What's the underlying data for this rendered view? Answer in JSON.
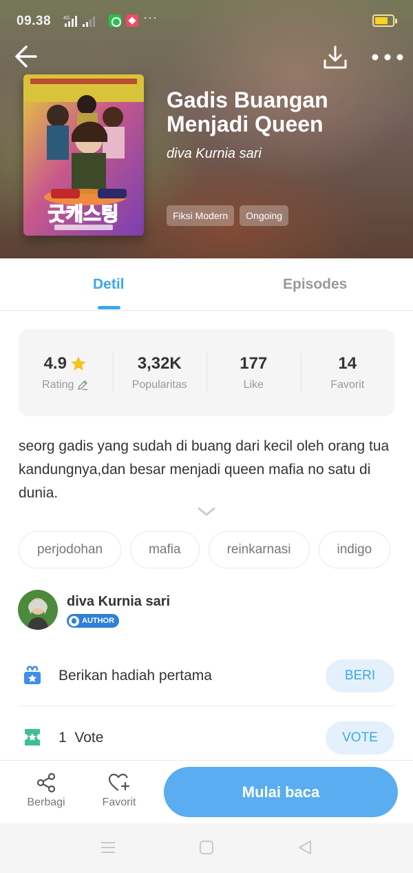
{
  "status_bar": {
    "time": "09.38",
    "network": "4G",
    "more": "···"
  },
  "book": {
    "title": "Gadis Buangan Menjadi Queen",
    "author": "diva Kurnia sari",
    "tags": [
      "Fiksi Modern",
      "Ongoing"
    ]
  },
  "tabs": [
    "Detil",
    "Episodes"
  ],
  "stats": [
    {
      "value": "4.9",
      "label": "Rating"
    },
    {
      "value": "3,32K",
      "label": "Popularitas"
    },
    {
      "value": "177",
      "label": "Like"
    },
    {
      "value": "14",
      "label": "Favorit"
    }
  ],
  "description": "seorg gadis yang sudah di buang dari kecil oleh orang tua kandungnya,dan besar menjadi queen mafia no satu di dunia.",
  "keywords": [
    "perjodohan",
    "mafia",
    "reinkarnasi",
    "indigo"
  ],
  "author_section": {
    "name": "diva Kurnia sari",
    "badge": "AUTHOR"
  },
  "gift": {
    "text": "Berikan hadiah pertama",
    "button": "BERI"
  },
  "vote": {
    "text": "1  Vote",
    "button": "VOTE"
  },
  "bottom_bar": {
    "share": "Berbagi",
    "favorite": "Favorit",
    "start": "Mulai baca"
  },
  "colors": {
    "accent": "#3aa8ee",
    "button": "#5aadf0",
    "star": "#f7c21c"
  }
}
